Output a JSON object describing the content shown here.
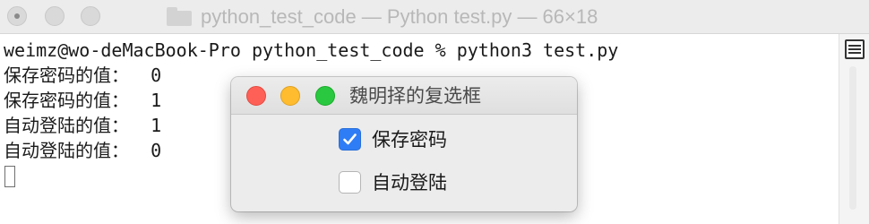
{
  "terminal": {
    "title": "python_test_code — Python test.py — 66×18",
    "lines": [
      "weimz@wo-deMacBook-Pro python_test_code % python3 test.py",
      "保存密码的值：  0",
      "保存密码的值：  1",
      "自动登陆的值：  1",
      "自动登陆的值：  0"
    ]
  },
  "dialog": {
    "title": "魏明择的复选框",
    "checkboxes": [
      {
        "label": "保存密码",
        "checked": true
      },
      {
        "label": "自动登陆",
        "checked": false
      }
    ]
  },
  "colors": {
    "accent": "#2f7df6",
    "close": "#fe5f57",
    "minimize": "#febc2e",
    "zoom": "#29c840"
  }
}
